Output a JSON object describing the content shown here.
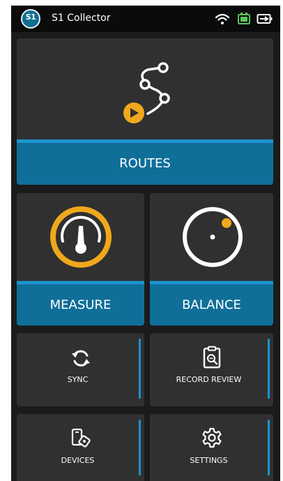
{
  "status_bar": {
    "app_logo_text": "S1",
    "app_title": "S1 Collector",
    "icons": [
      "wifi-icon",
      "battery-icon",
      "battery-charging-icon"
    ]
  },
  "tiles": {
    "routes": {
      "label": "ROUTES",
      "icon": "route-path-icon"
    },
    "measure": {
      "label": "MEASURE",
      "icon": "gauge-icon"
    },
    "balance": {
      "label": "BALANCE",
      "icon": "balance-dial-icon"
    },
    "sync": {
      "label": "SYNC",
      "icon": "sync-icon"
    },
    "record_review": {
      "label": "RECORD REVIEW",
      "icon": "clipboard-review-icon"
    },
    "devices": {
      "label": "DEVICES",
      "icon": "devices-icon"
    },
    "settings": {
      "label": "SETTINGS",
      "icon": "gear-icon"
    }
  },
  "colors": {
    "accent_blue": "#1d93cf",
    "label_bar_blue": "#0f6f99",
    "highlight_orange": "#f0a81c",
    "tile_bg": "#303030",
    "screen_bg": "#1b1b1b"
  }
}
